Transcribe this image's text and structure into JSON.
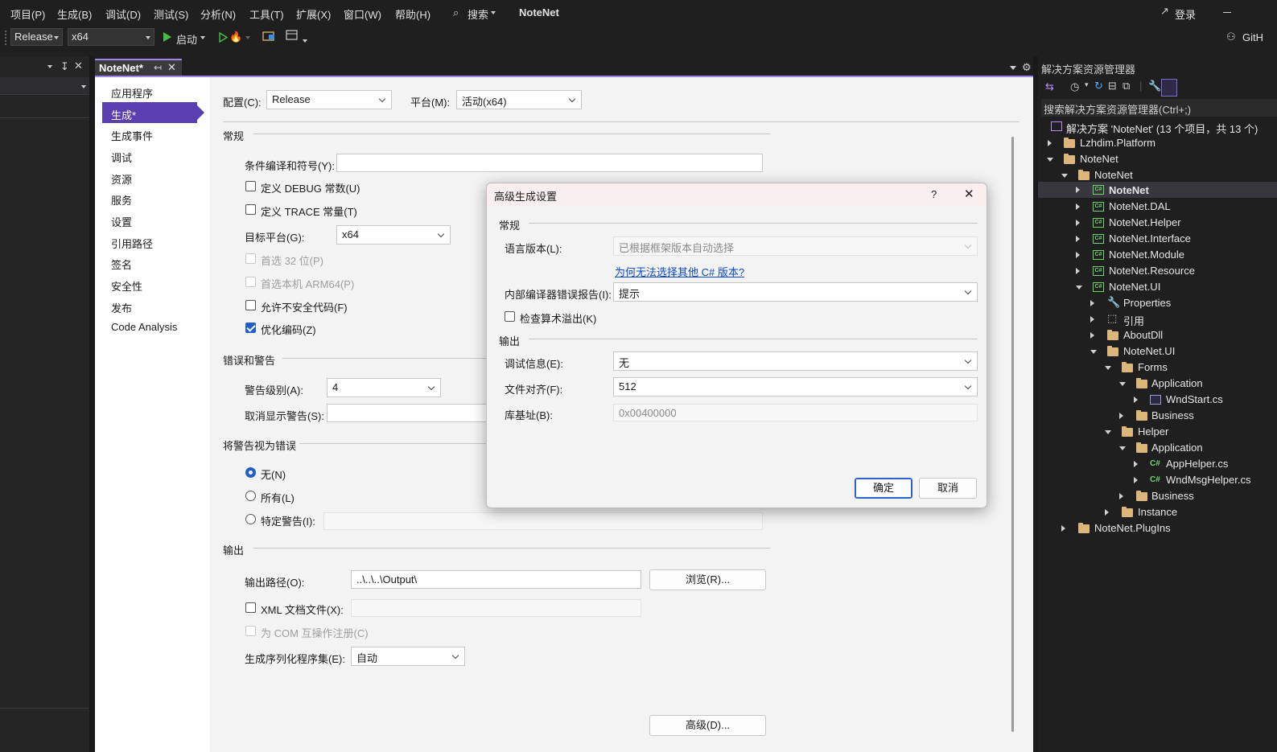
{
  "menubar": {
    "items": [
      "项目(P)",
      "生成(B)",
      "调试(D)",
      "测试(S)",
      "分析(N)",
      "工具(T)",
      "扩展(X)",
      "窗口(W)",
      "帮助(H)"
    ],
    "search": "搜索",
    "app_title": "NoteNet",
    "login": "登录",
    "github": "GitH"
  },
  "toolbar": {
    "config": "Release",
    "platform": "x64",
    "start": "启动"
  },
  "doc_tab": {
    "title": "NoteNet*"
  },
  "nav": {
    "items": [
      "应用程序",
      "生成*",
      "生成事件",
      "调试",
      "资源",
      "服务",
      "设置",
      "引用路径",
      "签名",
      "安全性",
      "发布",
      "Code Analysis"
    ],
    "selected": 1
  },
  "build": {
    "config_label": "配置(C):",
    "config_value": "Release",
    "platform_label": "平台(M):",
    "platform_value": "活动(x64)",
    "general": {
      "title": "常规",
      "cond_symbols_label": "条件编译和符号(Y):",
      "cond_symbols_value": "",
      "define_debug": "定义 DEBUG 常数(U)",
      "define_trace": "定义 TRACE 常量(T)",
      "target_platform_label": "目标平台(G):",
      "target_platform_value": "x64",
      "prefer32": "首选 32 位(P)",
      "prefer_arm64": "首选本机 ARM64(P)",
      "allow_unsafe": "允许不安全代码(F)",
      "optimize": "优化编码(Z)"
    },
    "errors": {
      "title": "错误和警告",
      "warn_level_label": "警告级别(A):",
      "warn_level_value": "4",
      "suppress_label": "取消显示警告(S):",
      "suppress_value": ""
    },
    "treat_warnings": {
      "title": "将警告视为错误",
      "none": "无(N)",
      "all": "所有(L)",
      "specific": "特定警告(I):"
    },
    "output": {
      "title": "输出",
      "path_label": "输出路径(O):",
      "path_value": "..\\..\\..\\Output\\",
      "browse": "浏览(R)...",
      "xml_doc": "XML 文档文件(X):",
      "com_register": "为 COM 互操作注册(C)",
      "serialization_label": "生成序列化程序集(E):",
      "serialization_value": "自动"
    },
    "advanced_button": "高级(D)..."
  },
  "dialog": {
    "title": "高级生成设置",
    "help": "?",
    "general_title": "常规",
    "lang_label": "语言版本(L):",
    "lang_value": "已根据框架版本自动选择",
    "lang_link": "为何无法选择其他 C# 版本?",
    "ice_label": "内部编译器错误报告(I):",
    "ice_value": "提示",
    "overflow": "检查算术溢出(K)",
    "output_title": "输出",
    "debug_info_label": "调试信息(E):",
    "debug_info_value": "无",
    "file_align_label": "文件对齐(F):",
    "file_align_value": "512",
    "base_addr_label": "库基址(B):",
    "base_addr_value": "0x00400000",
    "ok": "确定",
    "cancel": "取消"
  },
  "solution": {
    "title": "解决方案资源管理器",
    "search": "搜索解决方案资源管理器(Ctrl+;)",
    "root": "解决方案 'NoteNet' (13 个项目，共 13 个)",
    "nodes": [
      {
        "label": "Lzhdim.Platform",
        "icon": "folder"
      },
      {
        "label": "NoteNet",
        "icon": "folder"
      },
      {
        "label": "NoteNet",
        "icon": "folder"
      },
      {
        "label": "NoteNet",
        "icon": "csproj"
      },
      {
        "label": "NoteNet.DAL",
        "icon": "csproj"
      },
      {
        "label": "NoteNet.Helper",
        "icon": "csproj"
      },
      {
        "label": "NoteNet.Interface",
        "icon": "csproj"
      },
      {
        "label": "NoteNet.Module",
        "icon": "csproj"
      },
      {
        "label": "NoteNet.Resource",
        "icon": "csproj"
      },
      {
        "label": "NoteNet.UI",
        "icon": "csproj"
      },
      {
        "label": "Properties",
        "icon": "wrench"
      },
      {
        "label": "引用",
        "icon": "references"
      },
      {
        "label": "AboutDll",
        "icon": "folder"
      },
      {
        "label": "NoteNet.UI",
        "icon": "folder"
      },
      {
        "label": "Forms",
        "icon": "folder"
      },
      {
        "label": "Application",
        "icon": "folder"
      },
      {
        "label": "WndStart.cs",
        "icon": "form"
      },
      {
        "label": "Business",
        "icon": "folder"
      },
      {
        "label": "Helper",
        "icon": "folder"
      },
      {
        "label": "Application",
        "icon": "folder"
      },
      {
        "label": "AppHelper.cs",
        "icon": "csfile"
      },
      {
        "label": "WndMsgHelper.cs",
        "icon": "csfile"
      },
      {
        "label": "Business",
        "icon": "folder"
      },
      {
        "label": "Instance",
        "icon": "folder"
      },
      {
        "label": "NoteNet.PlugIns",
        "icon": "folder"
      }
    ]
  },
  "colors": {
    "accent": "#9d86e9",
    "nav_selected": "#5a3fb0",
    "link": "#0b49c9",
    "folder": "#dcb67a",
    "project": "#6fd46f"
  }
}
